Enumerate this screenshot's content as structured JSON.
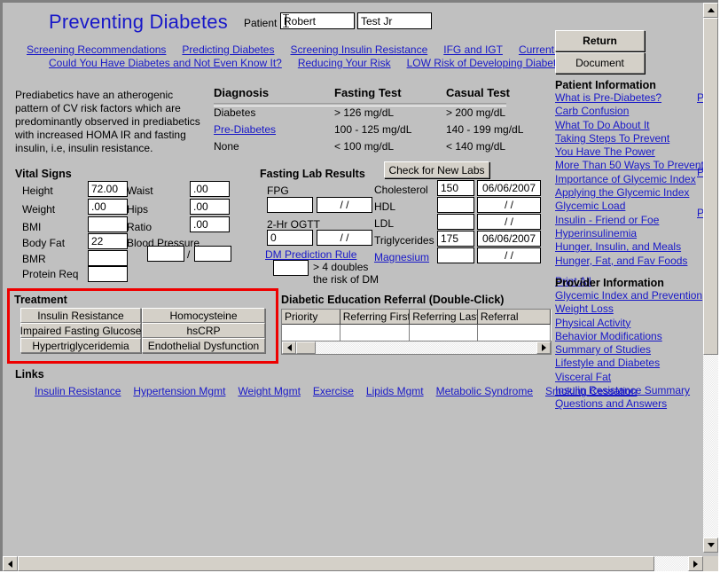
{
  "window": {
    "title": "Preventing Diabetes"
  },
  "header": {
    "title": "Preventing Diabetes",
    "patient_label": "Patient",
    "patient_first": "Robert",
    "patient_last": "Test Jr",
    "patient_first_placeholder": "",
    "patient_last_placeholder": ""
  },
  "nav": {
    "row1": [
      "Screening Recommendations",
      "Predicting Diabetes",
      "Screening Insulin Resistance",
      "IFG and IGT",
      "Current Strategies"
    ],
    "row2": [
      "Could You Have Diabetes and Not Even Know It?",
      "Reducing Your Risk",
      "LOW Risk of Developing Diabetes"
    ]
  },
  "buttons": {
    "return": "Return",
    "document": "Document",
    "check_new_labs": "Check for New Labs"
  },
  "blurb": "Prediabetics  have an atherogenic pattern of CV risk factors which are predominantly observed in prediabetics with increased HOMA IR and fasting insulin, i.e, insulin resistance.",
  "diagnosis_table": {
    "headers": [
      "Diagnosis",
      "Fasting Test",
      "Casual Test"
    ],
    "rows": [
      {
        "diagnosis": "Diabetes",
        "is_link": false,
        "fasting": "> 126 mg/dL",
        "casual": "> 200 mg/dL"
      },
      {
        "diagnosis": "Pre-Diabetes",
        "is_link": true,
        "fasting": "100 - 125 mg/dL",
        "casual": "140 - 199 mg/dL"
      },
      {
        "diagnosis": "None",
        "is_link": false,
        "fasting": "< 100 mg/dL",
        "casual": "< 140 mg/dL"
      }
    ]
  },
  "vital_signs": {
    "caption": "Vital Signs",
    "left": [
      {
        "label": "Height",
        "value": "72.00"
      },
      {
        "label": "Weight",
        "value": ".00"
      },
      {
        "label": "BMI",
        "value": ""
      },
      {
        "label": "Body Fat",
        "value": "22"
      },
      {
        "label": "BMR",
        "value": ""
      },
      {
        "label": "Protein Req",
        "value": ""
      }
    ],
    "right": [
      {
        "label": "Waist",
        "value": ".00"
      },
      {
        "label": "Hips",
        "value": ".00"
      },
      {
        "label": "Ratio",
        "value": ".00"
      }
    ],
    "blood_pressure_label": "Blood Pressure",
    "bp_systolic": "",
    "bp_diastolic": "",
    "bp_separator": "/"
  },
  "fasting_labs": {
    "caption": "Fasting Lab Results",
    "fpg_label": "FPG",
    "fpg_value": "",
    "fpg_date": "/ /",
    "ogtt_label": "2-Hr OGTT",
    "ogtt_value": "0",
    "ogtt_date": "/ /",
    "dm_rule_link": "DM Prediction Rule",
    "dm_rule_value": "",
    "dm_rule_note_line1": "> 4 doubles",
    "dm_rule_note_line2": "the risk of DM",
    "panel": [
      {
        "label": "Cholesterol",
        "is_link": false,
        "value": "150",
        "date": "06/06/2007"
      },
      {
        "label": "HDL",
        "is_link": false,
        "value": "",
        "date": "/ /"
      },
      {
        "label": "LDL",
        "is_link": false,
        "value": "",
        "date": "/ /"
      },
      {
        "label": "Triglycerides",
        "is_link": false,
        "value": "175",
        "date": "06/06/2007"
      },
      {
        "label": "Magnesium",
        "is_link": true,
        "value": "",
        "date": "/ /"
      }
    ]
  },
  "treatment": {
    "caption": "Treatment",
    "highlight_color": "#ee0000",
    "buttons": [
      "Insulin Resistance",
      "Homocysteine",
      "Impaired Fasting Glucose",
      "hsCRP",
      "Hypertriglyceridemia",
      "Endothelial Dysfunction"
    ]
  },
  "referral": {
    "caption": "Diabetic Education Referral (Double-Click)",
    "headers": [
      "Priority",
      "Referring First",
      "Referring Last",
      "Referral"
    ],
    "rows": [
      {
        "priority": "",
        "referring_first": "",
        "referring_last": "",
        "referral": ""
      }
    ]
  },
  "links_section": {
    "caption": "Links",
    "items": [
      "Insulin Resistance",
      "Hypertension Mgmt",
      "Weight Mgmt",
      "Exercise",
      "Lipids Mgmt",
      "Metabolic Syndrome",
      "Smoking Cessation"
    ]
  },
  "sidebar": {
    "patient_information": {
      "heading": "Patient Information",
      "items": [
        "What is Pre-Diabetes?",
        "Carb Confusion",
        "What To Do About It",
        "Taking Steps To Prevent",
        "You Have The Power",
        "More Than 50 Ways To Prevent",
        "Importance of Glycemic Index",
        "Applying the Glycemic Index",
        "Glycemic Load",
        "Insulin - Friend or Foe",
        "Hyperinsulinemia",
        "Hunger, Insulin, and Meals",
        "Hunger, Fat, and Fav Foods"
      ],
      "print_all": "Print All"
    },
    "provider_information": {
      "heading": "Provider Information",
      "items": [
        "Glycemic Index and Prevention",
        "Weight Loss",
        "Physical Activity",
        "Behavior Modifications",
        "Summary of Studies",
        "Lifestyle and Diabetes",
        "Visceral Fat",
        "Insulin Resistance Summary",
        "Questions and Answers"
      ]
    },
    "clipped_fragments": [
      "Pr",
      "Pr",
      "Pr"
    ]
  },
  "colors": {
    "link": "#1818c8",
    "title": "#1818c8",
    "background": "#c0c0c0",
    "control_face": "#d4d0c8",
    "treatment_highlight": "#ee0000"
  }
}
